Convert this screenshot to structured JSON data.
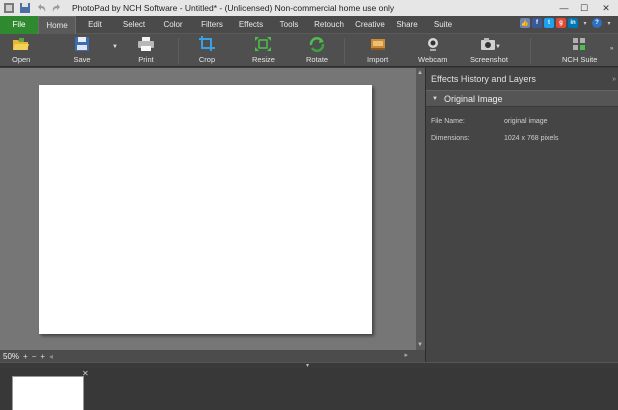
{
  "window": {
    "title": "PhotoPad by NCH Software - Untitled* - (Unlicensed) Non-commercial home use only",
    "min": "—",
    "max": "☐",
    "close": "✕"
  },
  "menu": {
    "tabs": [
      "File",
      "Home",
      "Edit",
      "Select",
      "Color",
      "Filters",
      "Effects",
      "Tools",
      "Retouch",
      "Creative",
      "Share",
      "Suite"
    ],
    "active": "Home"
  },
  "toolbar": {
    "open": "Open",
    "save": "Save",
    "print": "Print",
    "crop": "Crop",
    "resize": "Resize",
    "rotate": "Rotate",
    "import": "Import",
    "webcam": "Webcam",
    "screenshot": "Screenshot",
    "nch_suite": "NCH Suite"
  },
  "status": {
    "zoom": "50%",
    "zoom_in": "+",
    "zoom_out": "−",
    "zoom_add": "+"
  },
  "panel": {
    "title": "Effects History and Layers",
    "layer_name": "Original Image",
    "props": [
      {
        "label": "File Name:",
        "value": "original image"
      },
      {
        "label": "Dimensions:",
        "value": "1024 x 768 pixels"
      }
    ]
  },
  "colors": {
    "file_tab": "#2f8a2f",
    "toolbar": "#4f4f4f",
    "canvas": "#767676",
    "panel": "#454545"
  }
}
